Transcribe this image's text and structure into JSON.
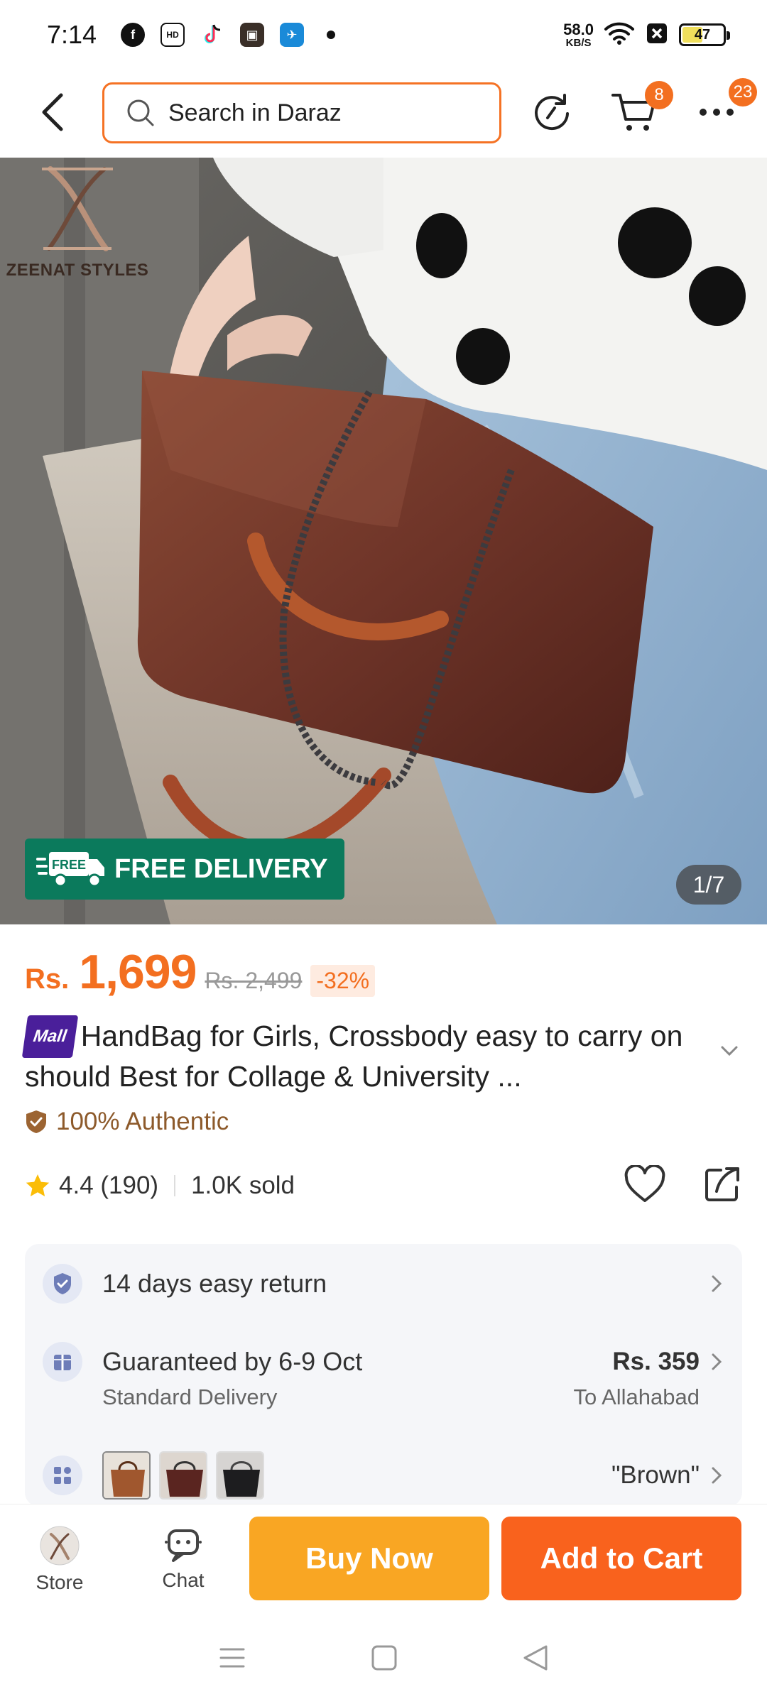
{
  "status_bar": {
    "time": "7:14",
    "net_speed_value": "58.0",
    "net_speed_unit": "KB/S",
    "battery": "47"
  },
  "header": {
    "search_placeholder": "Search in Daraz",
    "cart_badge": "8",
    "more_badge": "23"
  },
  "product_image": {
    "brand_name": "ZEENAT STYLES",
    "free_delivery_icon_text": "FREE",
    "free_delivery_label": "FREE DELIVERY",
    "counter": "1/7"
  },
  "price": {
    "currency": "Rs.",
    "current": "1,699",
    "original": "Rs. 2,499",
    "discount": "-32%"
  },
  "product": {
    "mall_badge": "Mall",
    "title": "HandBag for Girls, Crossbody easy to carry on should Best for Collage & University ...",
    "authentic": "100% Authentic",
    "rating": "4.4 (190)",
    "sold": "1.0K sold"
  },
  "info_card": {
    "return_text": "14 days easy return",
    "delivery_main": "Guaranteed by 6-9 Oct",
    "delivery_sub": "Standard Delivery",
    "delivery_price": "Rs. 359",
    "delivery_location": "To Allahabad",
    "variant_selected": "\"Brown\""
  },
  "action_bar": {
    "store_label": "Store",
    "chat_label": "Chat",
    "buy_now": "Buy Now",
    "add_to_cart": "Add to Cart"
  },
  "colors": {
    "accent": "#f36f20",
    "buy_now": "#f9a623",
    "add_to_cart": "#f9621d",
    "free_delivery": "#0b7a5c",
    "mall": "#4a1f9a"
  }
}
